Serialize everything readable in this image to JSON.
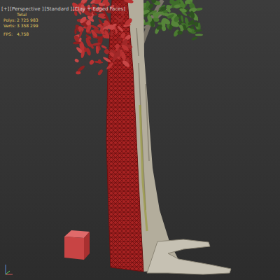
{
  "viewport": {
    "menus": [
      "[+]",
      "[Perspective ]",
      "[Standard ]",
      "[Clay + Edged Faces]"
    ]
  },
  "stats": {
    "header": "Total",
    "rows": [
      {
        "label": "Polys:",
        "value": "2 725 983"
      },
      {
        "label": "Verts:",
        "value": "3 358 299"
      },
      {
        "label": "FPS:",
        "value": "4,758"
      }
    ]
  }
}
